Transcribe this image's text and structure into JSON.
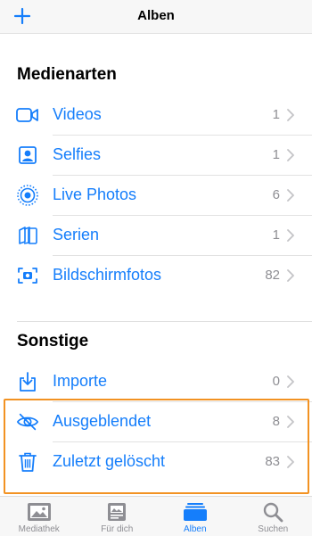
{
  "nav": {
    "title": "Alben",
    "add_icon": "plus-icon"
  },
  "colors": {
    "accent": "#157efb",
    "secondary": "#8e8e93",
    "highlight": "#f29222"
  },
  "sections": [
    {
      "title": "Medienarten",
      "items": [
        {
          "label": "Videos",
          "count": "1",
          "icon": "video-icon"
        },
        {
          "label": "Selfies",
          "count": "1",
          "icon": "selfie-icon"
        },
        {
          "label": "Live Photos",
          "count": "6",
          "icon": "live-photos-icon"
        },
        {
          "label": "Serien",
          "count": "1",
          "icon": "bursts-icon"
        },
        {
          "label": "Bildschirmfotos",
          "count": "82",
          "icon": "screenshot-icon"
        }
      ]
    },
    {
      "title": "Sonstige",
      "items": [
        {
          "label": "Importe",
          "count": "0",
          "icon": "import-icon"
        },
        {
          "label": "Ausgeblendet",
          "count": "8",
          "icon": "hidden-eye-icon"
        },
        {
          "label": "Zuletzt gelöscht",
          "count": "83",
          "icon": "trash-icon"
        }
      ]
    }
  ],
  "tabs": [
    {
      "label": "Mediathek",
      "icon": "photo-library-icon",
      "active": false
    },
    {
      "label": "Für dich",
      "icon": "for-you-icon",
      "active": false
    },
    {
      "label": "Alben",
      "icon": "albums-icon",
      "active": true
    },
    {
      "label": "Suchen",
      "icon": "search-icon",
      "active": false
    }
  ]
}
